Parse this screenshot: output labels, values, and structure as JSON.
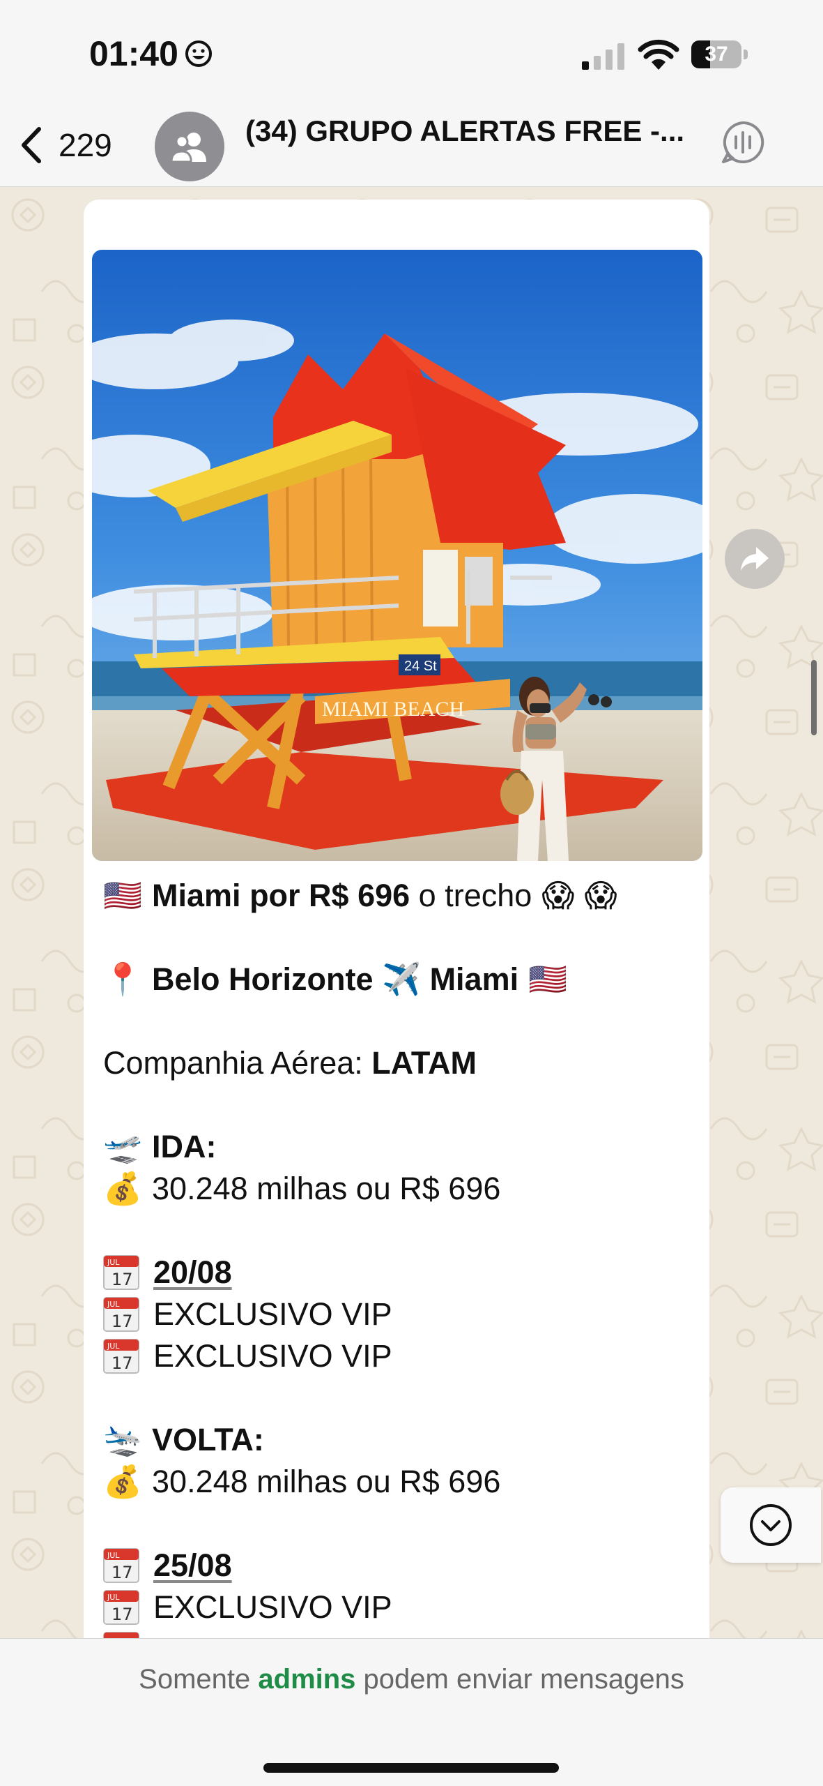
{
  "status_bar": {
    "time": "01:40",
    "battery": "37",
    "battery_level": 0.37
  },
  "header": {
    "back_count": "229",
    "group_title": "(34) GRUPO ALERTAS FREE -..."
  },
  "message": {
    "photo_sign": "MIAMI BEACH",
    "photo_tower_number": "24 St",
    "lines": {
      "headline_prefix": "🇺🇸",
      "headline_bold": "Miami por R$ 696",
      "headline_rest": " o trecho",
      "headline_suffix": "😱 😱",
      "route_pin": "📍",
      "route_bold": "Belo Horizonte ✈️ Miami",
      "route_flag": "🇺🇸",
      "airline_label": "Companhia Aérea: ",
      "airline_value": "LATAM",
      "ida_icon": "🛫",
      "ida_label": "IDA:",
      "money_icon": "💰",
      "ida_price": "30.248 milhas ou R$ 696",
      "cal_month": "JUL",
      "cal_day": "17",
      "ida_date": "20/08",
      "vip_1": "EXCLUSIVO VIP",
      "vip_2": "EXCLUSIVO VIP",
      "volta_icon": "🛬",
      "volta_label": "VOLTA:",
      "volta_price": "30.248 milhas ou R$ 696",
      "volta_date": "25/08",
      "vip_3": "EXCLUSIVO VIP"
    }
  },
  "footer": {
    "notice_before": "Somente ",
    "notice_admins": "admins",
    "notice_after": " podem enviar mensagens"
  },
  "colors": {
    "accent_green": "#1e8c46",
    "wallpaper": "#efe8dc",
    "bubble": "#ffffff"
  },
  "icons": [
    "smiley-icon",
    "signal-icon",
    "wifi-icon",
    "battery-icon",
    "back-chevron-icon",
    "group-avatar-icon",
    "voice-chat-icon",
    "forward-icon",
    "chevron-down-icon",
    "calendar-icon"
  ]
}
